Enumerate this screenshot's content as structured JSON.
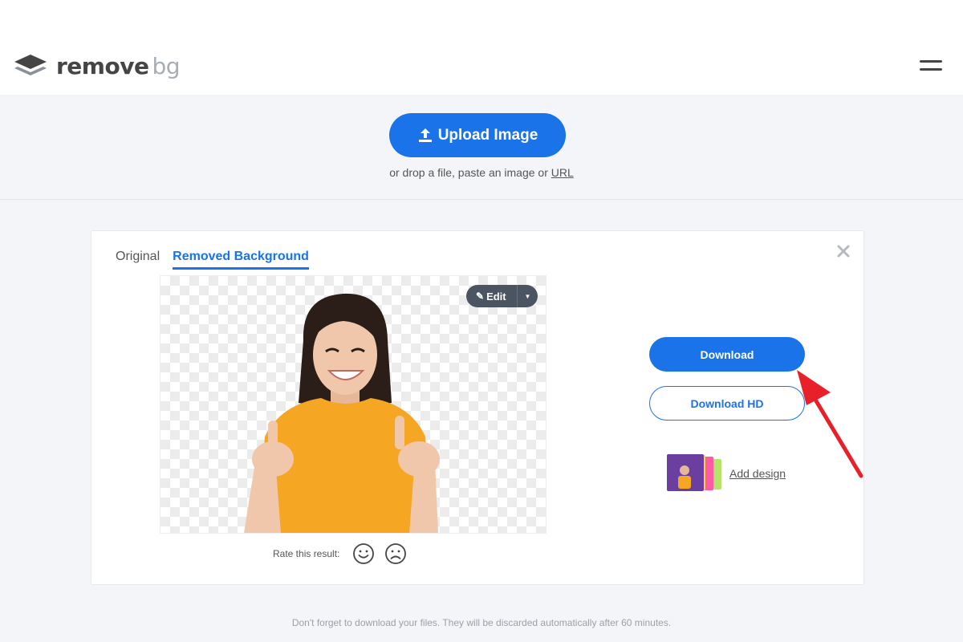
{
  "brand": {
    "name_main": "remove",
    "name_suffix": "bg"
  },
  "header": {
    "menu_icon": "hamburger-menu-icon"
  },
  "upload": {
    "button_label": "Upload Image",
    "drop_text_prefix": "or drop a file, paste an image or ",
    "drop_text_link": "URL"
  },
  "result": {
    "tabs": [
      {
        "label": "Original",
        "active": false
      },
      {
        "label": "Removed Background",
        "active": true
      }
    ],
    "edit_label": "Edit",
    "rate_label": "Rate this result:",
    "download_label": "Download",
    "download_hd_label": "Download HD",
    "add_design_label": "Add design"
  },
  "footer": {
    "note": "Don't forget to download your files. They will be discarded automatically after 60 minutes."
  },
  "colors": {
    "accent": "#1a73e8",
    "annotation_arrow": "#e8202a",
    "shirt": "#f5a623"
  }
}
